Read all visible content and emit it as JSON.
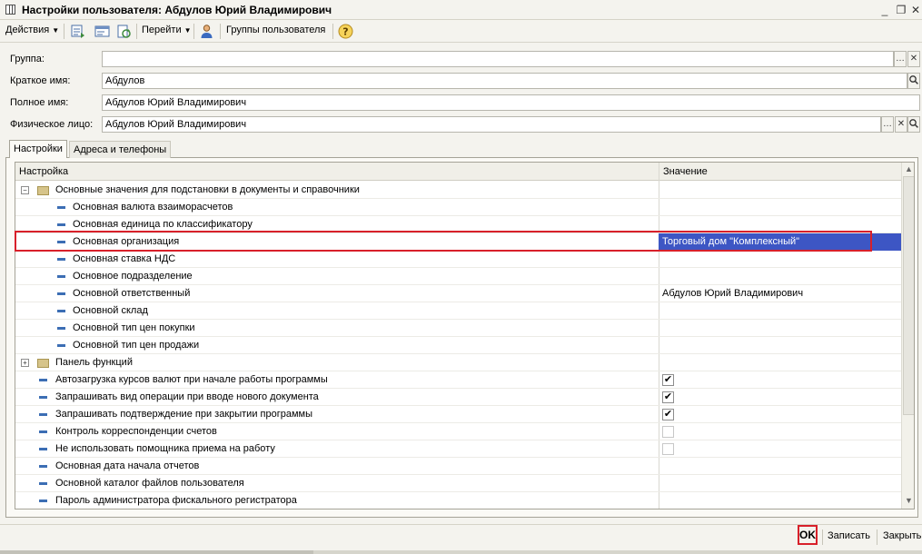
{
  "window": {
    "title": "Настройки пользователя: Абдулов Юрий Владимирович"
  },
  "toolbar": {
    "actions_label": "Действия",
    "goto_label": "Перейти",
    "user_groups_label": "Группы пользователя",
    "help_label": "?"
  },
  "form": {
    "group_label": "Группа:",
    "group_value": "",
    "short_name_label": "Краткое имя:",
    "short_name_value": "Абдулов",
    "full_name_label": "Полное имя:",
    "full_name_value": "Абдулов Юрий Владимирович",
    "person_label": "Физическое лицо:",
    "person_value": "Абдулов Юрий Владимирович"
  },
  "tabs": [
    {
      "label": "Настройки",
      "active": true
    },
    {
      "label": "Адреса и телефоны",
      "active": false
    }
  ],
  "grid": {
    "col_setting": "Настройка",
    "col_value": "Значение",
    "rows": [
      {
        "name": "Основные значения для подстановки в документы и справочники",
        "value": ""
      },
      {
        "name": "Основная валюта взаиморасчетов",
        "value": ""
      },
      {
        "name": "Основная единица по классификатору",
        "value": ""
      },
      {
        "name": "Основная организация",
        "value": "Торговый дом \"Комплексный\""
      },
      {
        "name": "Основная ставка НДС",
        "value": ""
      },
      {
        "name": "Основное подразделение",
        "value": ""
      },
      {
        "name": "Основной ответственный",
        "value": "Абдулов Юрий Владимирович"
      },
      {
        "name": "Основной склад",
        "value": ""
      },
      {
        "name": "Основной тип цен покупки",
        "value": ""
      },
      {
        "name": "Основной тип цен продажи",
        "value": ""
      },
      {
        "name": "Панель функций",
        "value": ""
      },
      {
        "name": "Автозагрузка курсов валют при начале работы программы",
        "value": ""
      },
      {
        "name": "Запрашивать вид операции при вводе нового документа",
        "value": ""
      },
      {
        "name": "Запрашивать подтверждение при закрытии программы",
        "value": ""
      },
      {
        "name": "Контроль корреспонденции счетов",
        "value": ""
      },
      {
        "name": "Не использовать помощника приема на работу",
        "value": ""
      },
      {
        "name": "Основная дата начала отчетов",
        "value": ""
      },
      {
        "name": "Основной каталог файлов пользователя",
        "value": ""
      },
      {
        "name": "Пароль администратора фискального регистратора",
        "value": ""
      }
    ],
    "checks": [
      true,
      true,
      true,
      false,
      false
    ]
  },
  "bottom": {
    "ok_label": "OK",
    "save_label": "Записать",
    "close_label": "Закрыть"
  }
}
